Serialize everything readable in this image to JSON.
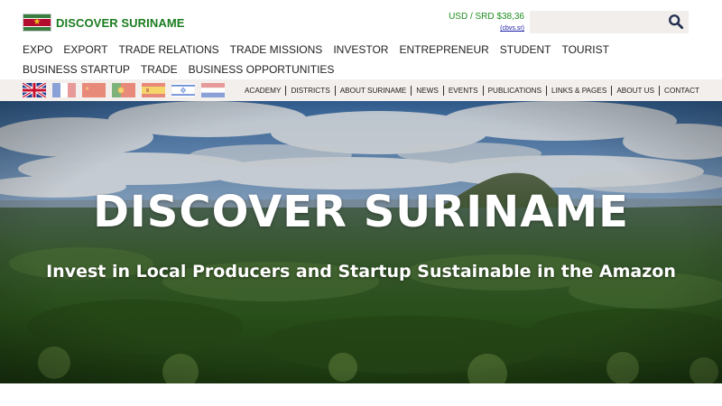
{
  "header": {
    "logo_text": "DISCOVER SURINAME",
    "currency_rate": "USD / SRD $38,36",
    "rate_source": "(cbvs.sr)",
    "search_placeholder": ""
  },
  "main_nav": [
    "EXPO",
    "EXPORT",
    "TRADE RELATIONS",
    "TRADE MISSIONS",
    "INVESTOR",
    "ENTREPRENEUR",
    "STUDENT",
    "TOURIST",
    "BUSINESS STARTUP",
    "TRADE",
    "BUSINESS OPPORTUNITIES"
  ],
  "language_flags": [
    "english-flag",
    "french-flag",
    "chinese-flag",
    "portuguese-flag",
    "spanish-flag",
    "israeli-flag",
    "dutch-flag"
  ],
  "sub_nav": [
    "ACADEMY",
    "DISTRICTS",
    "ABOUT SURINAME",
    "NEWS",
    "EVENTS",
    "PUBLICATIONS",
    "LINKS & PAGES",
    "ABOUT US",
    "CONTACT"
  ],
  "hero": {
    "title": "DISCOVER SURINAME",
    "subtitle": "Invest in Local Producers and Startup Sustainable in the Amazon"
  },
  "colors": {
    "brand_green": "#1b7d1f",
    "rate_green": "#1e8b1e",
    "subbar_bg": "#f3efec",
    "search_bg": "#f1eeeb"
  }
}
